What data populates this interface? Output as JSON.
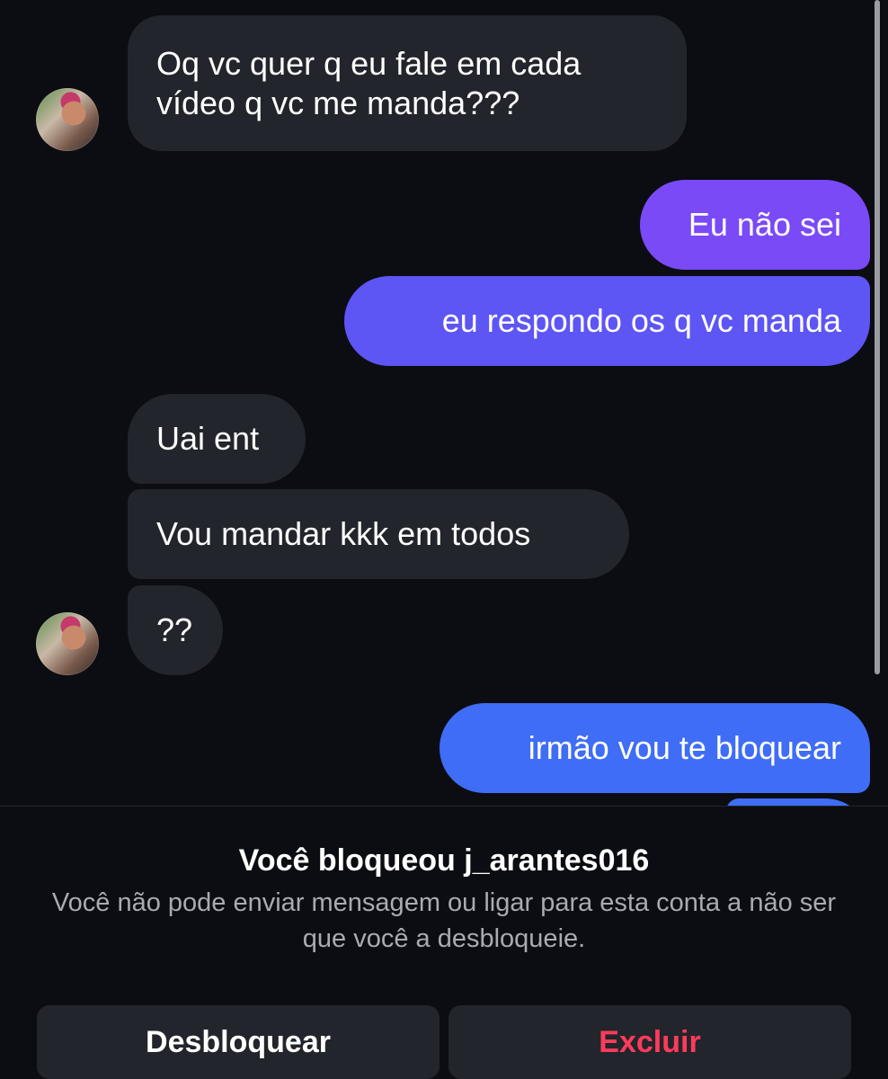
{
  "conversation": {
    "messages": [
      {
        "direction": "in",
        "lines": [
          "Oq vc quer q eu fale em cada",
          "vídeo q vc me manda???"
        ]
      },
      {
        "direction": "out",
        "text": "Eu não sei"
      },
      {
        "direction": "out",
        "text": "eu respondo os q vc manda"
      },
      {
        "direction": "in",
        "text": "Uai ent"
      },
      {
        "direction": "in",
        "text": "Vou mandar kkk em todos"
      },
      {
        "direction": "in",
        "text": "??"
      },
      {
        "direction": "out",
        "text": "irmão vou te bloquear"
      }
    ]
  },
  "blocked_notice": {
    "title": "Você bloqueou j_arantes016",
    "description": "Você não pode enviar mensagem ou ligar para esta conta a não ser que você a desbloqueie."
  },
  "actions": {
    "unblock_label": "Desbloquear",
    "delete_label": "Excluir"
  },
  "colors": {
    "background": "#0b0d12",
    "incoming_bubble": "#22252b",
    "outgoing_bubble_top": "#7a4af6",
    "outgoing_bubble_mid": "#5d55f4",
    "outgoing_bubble_bottom": "#3f6df6",
    "delete_text": "#ff3b5c",
    "muted_text": "#a8abb1"
  }
}
